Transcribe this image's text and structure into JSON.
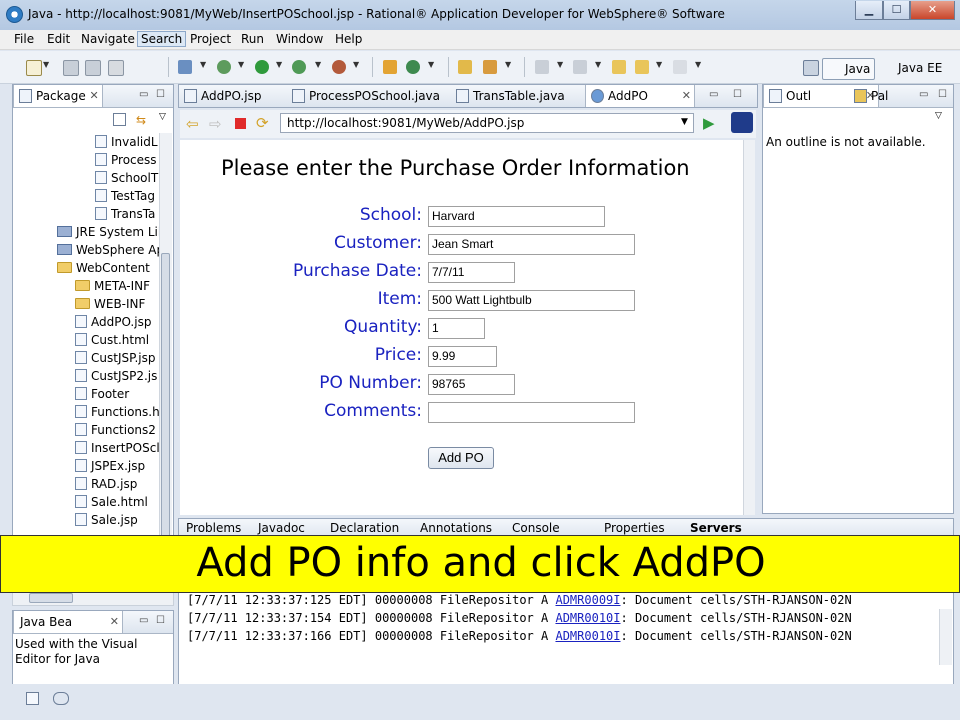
{
  "window": {
    "title": "Java - http://localhost:9081/MyWeb/InsertPOSchool.jsp - Rational® Application Developer for WebSphere® Software",
    "minimize": "▁",
    "maximize": "☐",
    "close": "✕"
  },
  "menu": [
    "File",
    "Edit",
    "Navigate",
    "Search",
    "Project",
    "Run",
    "Window",
    "Help"
  ],
  "perspectives": {
    "java": "Java",
    "javaee": "Java EE"
  },
  "package_explorer": {
    "tab": "Package",
    "items": [
      {
        "label": "InvalidL",
        "icon": "file"
      },
      {
        "label": "Process",
        "icon": "file"
      },
      {
        "label": "SchoolT",
        "icon": "file"
      },
      {
        "label": "TestTag",
        "icon": "file"
      },
      {
        "label": "TransTa",
        "icon": "file"
      },
      {
        "label": "JRE System Lib",
        "icon": "jar"
      },
      {
        "label": "WebSphere Ap",
        "icon": "jar"
      },
      {
        "label": "WebContent",
        "icon": "folder"
      },
      {
        "label": "META-INF",
        "icon": "folder"
      },
      {
        "label": "WEB-INF",
        "icon": "folder"
      },
      {
        "label": "AddPO.jsp",
        "icon": "file"
      },
      {
        "label": "Cust.html",
        "icon": "file"
      },
      {
        "label": "CustJSP.jsp",
        "icon": "file"
      },
      {
        "label": "CustJSP2.js",
        "icon": "file"
      },
      {
        "label": "Footer",
        "icon": "file"
      },
      {
        "label": "Functions.h",
        "icon": "file"
      },
      {
        "label": "Functions2",
        "icon": "file"
      },
      {
        "label": "InsertPOScl",
        "icon": "file"
      },
      {
        "label": "JSPEx.jsp",
        "icon": "file"
      },
      {
        "label": "RAD.jsp",
        "icon": "file"
      },
      {
        "label": "Sale.html",
        "icon": "file"
      },
      {
        "label": "Sale.jsp",
        "icon": "file"
      }
    ]
  },
  "editor_tabs": [
    {
      "label": "AddPO.jsp",
      "active": false
    },
    {
      "label": "ProcessPOSchool.java",
      "active": false
    },
    {
      "label": "TransTable.java",
      "active": false
    },
    {
      "label": "AddPO",
      "active": true
    }
  ],
  "browser": {
    "url": "http://localhost:9081/MyWeb/AddPO.jsp"
  },
  "form": {
    "heading": "Please enter the Purchase Order Information",
    "fields": [
      {
        "label": "School:",
        "value": "Harvard"
      },
      {
        "label": "Customer:",
        "value": "Jean Smart"
      },
      {
        "label": "Purchase Date:",
        "value": "7/7/11"
      },
      {
        "label": "Item:",
        "value": "500 Watt Lightbulb"
      },
      {
        "label": "Quantity:",
        "value": "1"
      },
      {
        "label": "Price:",
        "value": "9.99"
      },
      {
        "label": "PO Number:",
        "value": "98765"
      },
      {
        "label": "Comments:",
        "value": ""
      }
    ],
    "submit": "Add PO"
  },
  "outline": {
    "tab1": "Outl",
    "tab2": "Pal",
    "message": "An outline is not available."
  },
  "bottom_tabs": [
    "Problems",
    "Javadoc",
    "Declaration",
    "Annotations",
    "Console",
    "Properties",
    "Servers"
  ],
  "console": [
    {
      "prefix": "[7/7/11 12:33:37:125 EDT] 00000008 FileRepositor A  ",
      "code": "ADMR0009I",
      "rest": ": Document cells/STH-RJANSON-02N"
    },
    {
      "prefix": "[7/7/11 12:33:37:154 EDT] 00000008 FileRepositor A  ",
      "code": "ADMR0010I",
      "rest": ": Document cells/STH-RJANSON-02N"
    },
    {
      "prefix": "[7/7/11 12:33:37:166 EDT] 00000008 FileRepositor A  ",
      "code": "ADMR0010I",
      "rest": ": Document cells/STH-RJANSON-02N"
    }
  ],
  "javabeans": {
    "tab": "Java Bea",
    "text": "Used with the Visual Editor for Java"
  },
  "banner": "Add PO info and click AddPO",
  "colors": {
    "label_blue": "#1a22c0",
    "banner": "#ffff00"
  }
}
